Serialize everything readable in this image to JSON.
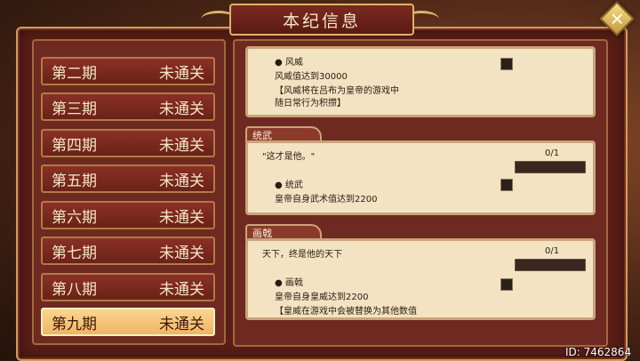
{
  "title": "本纪信息",
  "close_icon": "close-diamond-icon",
  "periods": [
    {
      "name": "第二期",
      "status": "未通关"
    },
    {
      "name": "第三期",
      "status": "未通关"
    },
    {
      "name": "第四期",
      "status": "未通关"
    },
    {
      "name": "第五期",
      "status": "未通关"
    },
    {
      "name": "第六期",
      "status": "未通关"
    },
    {
      "name": "第七期",
      "status": "未通关"
    },
    {
      "name": "第八期",
      "status": "未通关"
    },
    {
      "name": "第九期",
      "status": "未通关",
      "selected": true
    }
  ],
  "achievements": [
    {
      "tab": "",
      "quote": "",
      "progress": "",
      "item_title": "● 风威",
      "item_desc": "风威值达到30000",
      "item_note1": "【风威将在吕布为皇帝的游戏中",
      "item_note2": "随日常行为积攒】"
    },
    {
      "tab": "统武",
      "quote": "\"这才是他。\"",
      "progress": "0/1",
      "item_title": "● 统武",
      "item_desc": "皇帝自身武术值达到2200",
      "item_note1": "",
      "item_note2": ""
    },
    {
      "tab": "画戟",
      "quote": "天下，终是他的天下",
      "progress": "0/1",
      "item_title": "● 画戟",
      "item_desc": "皇帝自身皇威达到2200",
      "item_note1": "【皇威在游戏中会被替换为其他数值",
      "item_note2": ""
    }
  ],
  "footer_id": "ID: 7462864",
  "colors": {
    "accent": "#c9a25b",
    "panel": "#6e2a20",
    "card": "#f3e3c2",
    "active": "#f0b565"
  }
}
